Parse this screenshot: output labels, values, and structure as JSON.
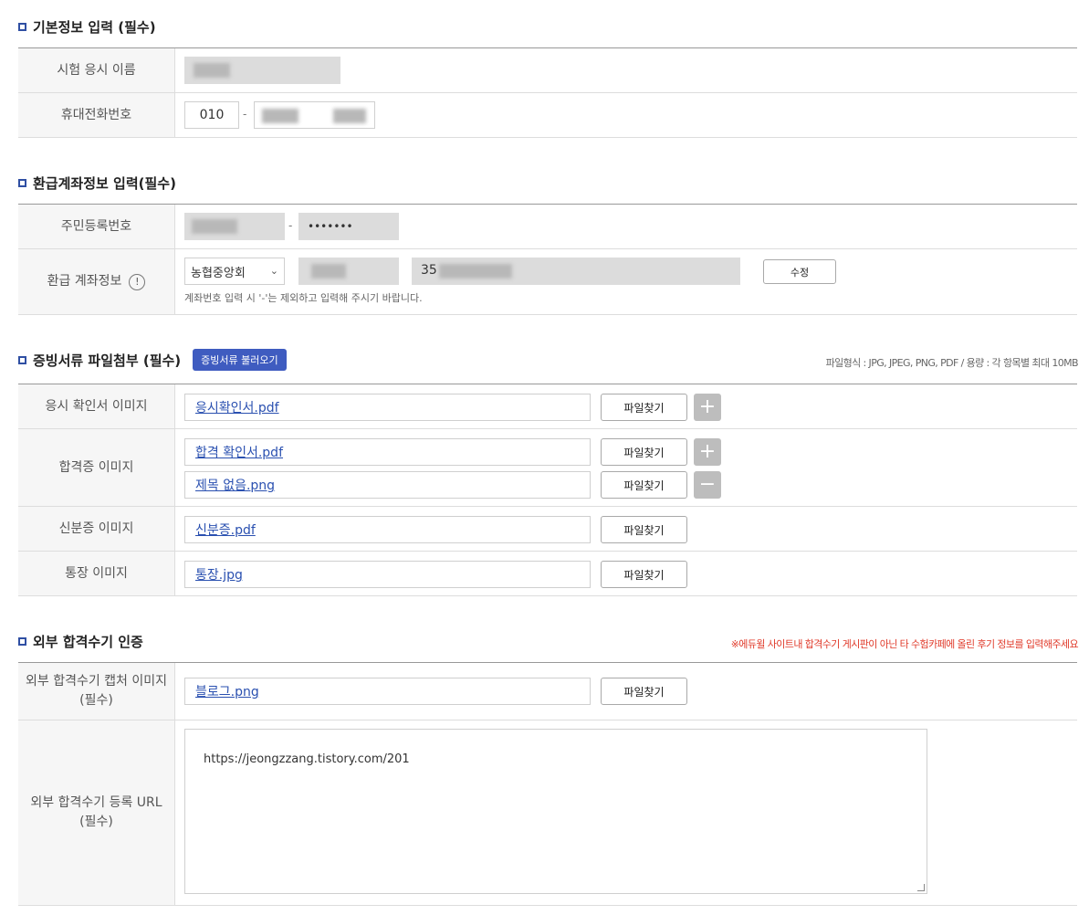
{
  "basic_info": {
    "title": "기본정보 입력 (필수)",
    "name_label": "시험 응시 이름",
    "phone_label": "휴대전화번호",
    "phone_prefix": "010",
    "dash": "-"
  },
  "refund": {
    "title": "환급계좌정보 입력(필수)",
    "ssn_label": "주민등록번호",
    "ssn_back": "•••••••",
    "account_label": "환급 계좌정보",
    "info_icon": "!",
    "bank_selected": "농협중앙회",
    "account_prefix": "35",
    "edit_button": "수정",
    "help_text": "계좌번호 입력 시 '-'는 제외하고 입력해 주시기 바랍니다."
  },
  "documents": {
    "title": "증빙서류 파일첨부 (필수)",
    "load_button": "증빙서류 불러오기",
    "file_info": "파일형식 : JPG, JPEG, PNG, PDF / 용량 : 각 항목별 최대 10MB",
    "find_button": "파일찾기",
    "rows": [
      {
        "label": "응시 확인서 이미지",
        "files": [
          "응시확인서.pdf"
        ]
      },
      {
        "label": "합격증 이미지",
        "files": [
          "합격 확인서.pdf",
          "제목 없음.png"
        ]
      },
      {
        "label": "신분증 이미지",
        "files": [
          "신분증.pdf"
        ]
      },
      {
        "label": "통장 이미지",
        "files": [
          "통장.jpg"
        ]
      }
    ]
  },
  "external": {
    "title": "외부 합격수기 인증",
    "notice": "※에듀윌 사이트내 합격수기 게시판이 아닌 타 수험카페에 올린 후기 정보를 입력해주세요",
    "capture_label": "외부 합격수기 캡처 이미지\n(필수)",
    "capture_file": "블로그.png",
    "find_button": "파일찾기",
    "url_label": "외부 합격수기 등록 URL\n(필수)",
    "url_value": "https://jeongzzang.tistory.com/201"
  },
  "colors": {
    "accent": "#2f4fa3",
    "button_blue": "#3f5cc0",
    "notice_red": "#e03a2a",
    "link": "#2a50b0"
  },
  "icons": {
    "plus": "plus-icon",
    "minus": "minus-icon",
    "chevron": "chevron-down-icon",
    "info": "info-icon"
  }
}
